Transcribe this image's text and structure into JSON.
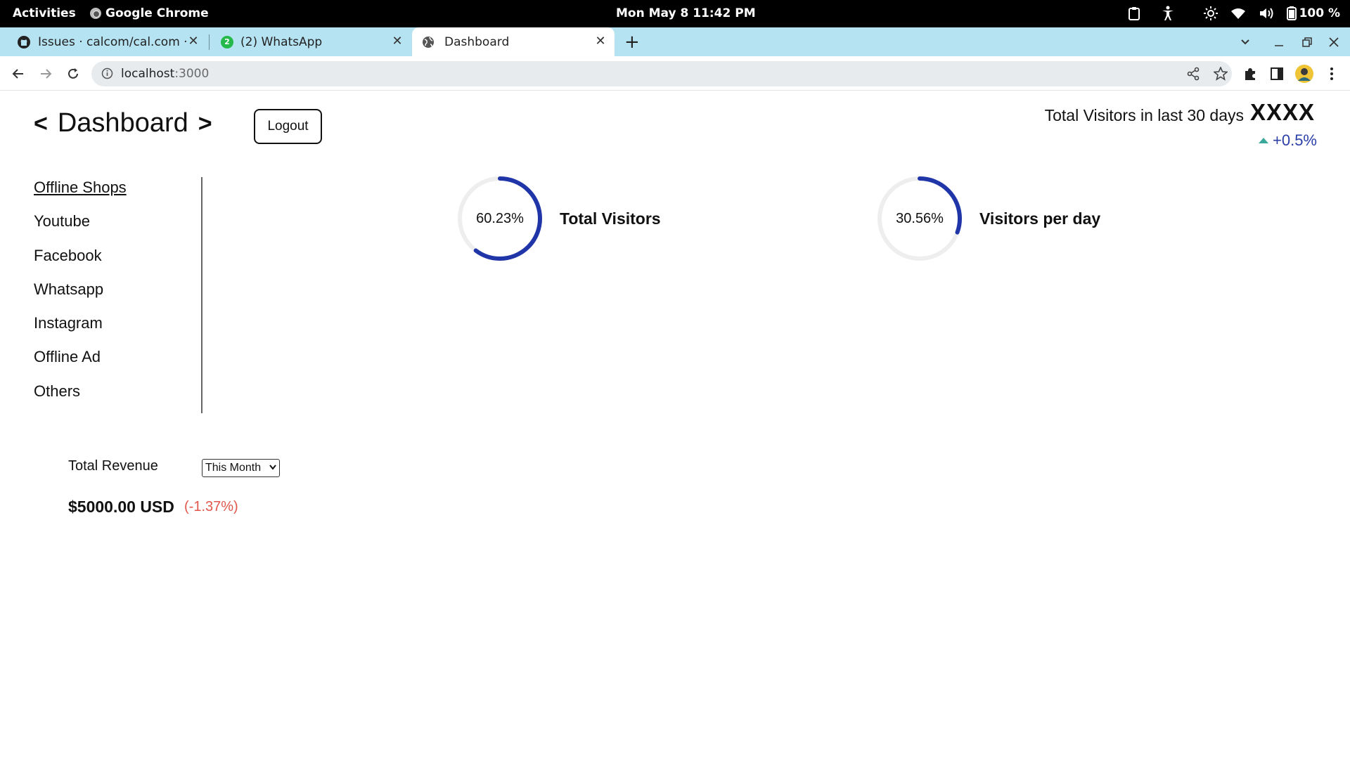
{
  "system_bar": {
    "activities": "Activities",
    "app_name": "Google Chrome",
    "clock": "Mon May 8  11:42 PM",
    "battery": "100 %"
  },
  "tabs": [
    {
      "title": "Issues · calcom/cal.com · G",
      "icon": "github-icon"
    },
    {
      "title": "(2) WhatsApp",
      "icon": "whatsapp-icon",
      "badge": "2"
    },
    {
      "title": "Dashboard",
      "icon": "globe-icon",
      "active": true
    }
  ],
  "address_bar": {
    "host": "localhost",
    "port": ":3000"
  },
  "header": {
    "title": "Dashboard",
    "prev": "<",
    "next": ">",
    "logout_label": "Logout"
  },
  "visitors_summary": {
    "label": "Total Visitors in last 30 days",
    "value": "XXXX",
    "change": "+0.5%"
  },
  "sidebar": {
    "items": [
      {
        "label": "Offline Shops",
        "active": true
      },
      {
        "label": "Youtube"
      },
      {
        "label": "Facebook"
      },
      {
        "label": "Whatsapp"
      },
      {
        "label": "Instagram"
      },
      {
        "label": "Offline Ad"
      },
      {
        "label": "Others"
      }
    ]
  },
  "stats": [
    {
      "percent_text": "60.23%",
      "percent": 60.23,
      "label": "Total Visitors"
    },
    {
      "percent_text": "30.56%",
      "percent": 30.56,
      "label": "Visitors per day"
    }
  ],
  "revenue": {
    "label": "Total Revenue",
    "period": "This Month",
    "amount": "$5000.00 USD",
    "change": "(-1.37%)"
  },
  "colors": {
    "ring_progress": "#2036a8",
    "ring_track": "#eeeeee",
    "positive": "#2a3ea8",
    "negative": "#e0564b",
    "tab_strip": "#b6e3f1"
  }
}
